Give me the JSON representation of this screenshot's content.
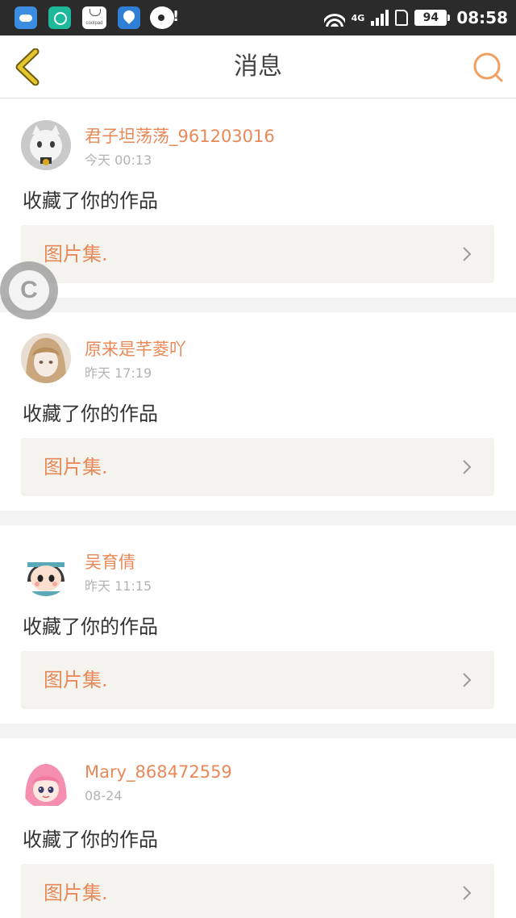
{
  "status_bar": {
    "network": "4G",
    "battery": "94",
    "time": "08:58",
    "coolpad_label": "coolpad"
  },
  "header": {
    "title": "消息"
  },
  "notifications": [
    {
      "username": "君子坦荡荡_961203016",
      "time": "今天 00:13",
      "action": "收藏了你的作品",
      "work_title": "图片集.",
      "avatar": "white-cat-avatar"
    },
    {
      "username": "原来是芊菱吖",
      "time": "昨天 17:19",
      "action": "收藏了你的作品",
      "work_title": "图片集.",
      "avatar": "anime-girl-avatar"
    },
    {
      "username": "吴育倩",
      "time": "昨天 11:15",
      "action": "收藏了你的作品",
      "work_title": "图片集.",
      "avatar": "cartoon-boy-avatar"
    },
    {
      "username": "Mary_868472559",
      "time": "08-24",
      "action": "收藏了你的作品",
      "work_title": "图片集.",
      "avatar": "pink-hair-girl-avatar"
    }
  ],
  "floating_button": {
    "label": "C"
  },
  "colors": {
    "accent": "#e8895a",
    "status_bar_bg": "#2b2b2b",
    "card_link_bg": "#f4f3ee",
    "back_arrow": "#e5c62f",
    "search_ring": "#f0a060"
  }
}
